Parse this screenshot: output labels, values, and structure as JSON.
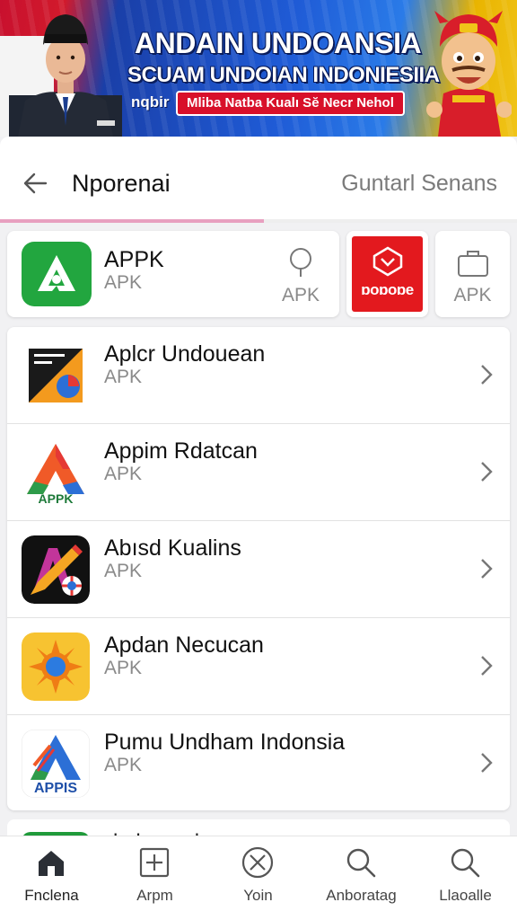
{
  "banner": {
    "line1": "ANDAIN UNDOANSIA",
    "line2": "SCUAM UNDOIAN INDONIESIIA",
    "tag": "nqbir",
    "pill": "Mliba Natba Kualı Sĕ Necr Nehol"
  },
  "header": {
    "title": "Nporenai",
    "action": "Guntarl Senans",
    "progress": 0.51
  },
  "tiles": {
    "main": {
      "title": "APPK",
      "subtitle": "APK",
      "pin_label": "APK"
    },
    "promo": {
      "label": "ɒoɒoɒe"
    },
    "bag": {
      "label": "APK"
    }
  },
  "apps": [
    {
      "title": "Aplcr Undouean",
      "subtitle": "APK",
      "icon": "orange-photo-icon"
    },
    {
      "title": "Appim Rdatcan",
      "subtitle": "APK",
      "icon": "apps-triangle-icon"
    },
    {
      "title": "Abısd Kualins",
      "subtitle": "APK",
      "icon": "pencil-letter-icon"
    },
    {
      "title": "Apdan Necucan",
      "subtitle": "APK",
      "icon": "sun-icon"
    },
    {
      "title": "Pumu Undham Indonsia",
      "subtitle": "APK",
      "icon": "apps-logo-icon"
    }
  ],
  "peek": {
    "text": "d ı l ı ı ı ı l"
  },
  "nav": [
    {
      "label": "Fnclena",
      "icon": "home-icon",
      "active": true
    },
    {
      "label": "Arpm",
      "icon": "add-square-icon"
    },
    {
      "label": "Yoin",
      "icon": "close-circle-icon"
    },
    {
      "label": "Anboratag",
      "icon": "search-icon"
    },
    {
      "label": "Llaoalle",
      "icon": "search-icon"
    }
  ],
  "colors": {
    "brand_green": "#22a63f",
    "promo_red": "#e3191e",
    "progress_pink": "#e8a0c0",
    "flag_red": "#c8102e",
    "banner_blue": "#1f5bd6"
  }
}
